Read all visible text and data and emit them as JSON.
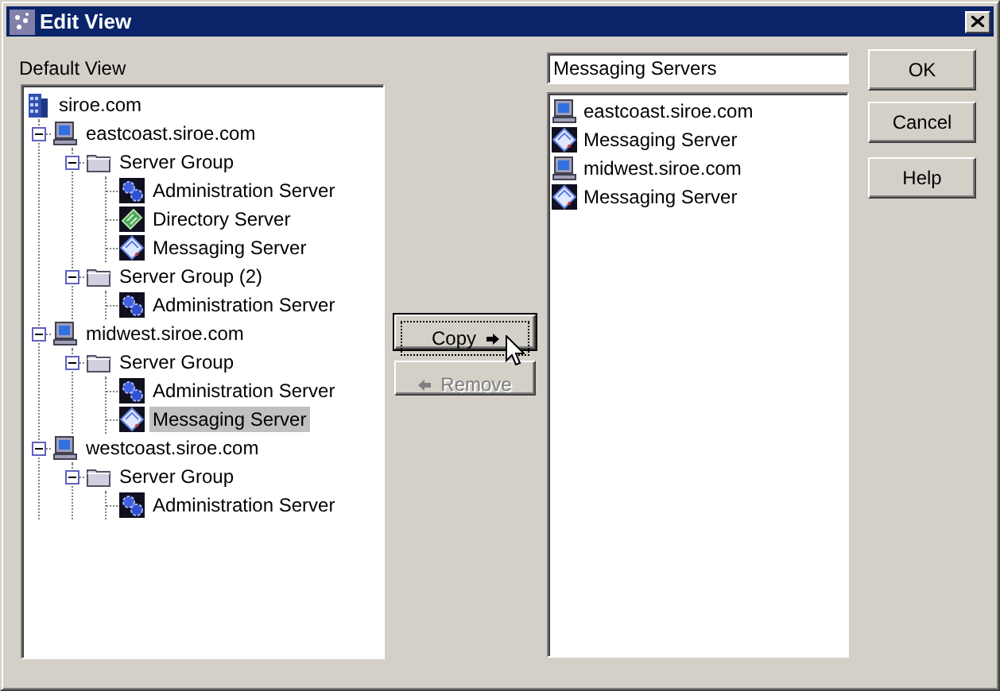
{
  "window": {
    "title": "Edit View"
  },
  "tree": {
    "label": "Default View",
    "nodes": [
      {
        "label": "siroe.com",
        "kind": "domain",
        "selected": false,
        "children": [
          {
            "label": "eastcoast.siroe.com",
            "kind": "host",
            "expanded": true,
            "selected": false,
            "children": [
              {
                "label": "Server Group",
                "kind": "folder",
                "expanded": true,
                "selected": false,
                "children": [
                  {
                    "label": "Administration Server",
                    "kind": "admin",
                    "selected": false
                  },
                  {
                    "label": "Directory Server",
                    "kind": "directory",
                    "selected": false
                  },
                  {
                    "label": "Messaging Server",
                    "kind": "messaging",
                    "selected": false
                  }
                ]
              },
              {
                "label": "Server Group (2)",
                "kind": "folder",
                "expanded": true,
                "selected": false,
                "children": [
                  {
                    "label": "Administration Server",
                    "kind": "admin",
                    "selected": false
                  }
                ]
              }
            ]
          },
          {
            "label": "midwest.siroe.com",
            "kind": "host",
            "expanded": true,
            "selected": false,
            "children": [
              {
                "label": "Server Group",
                "kind": "folder",
                "expanded": true,
                "selected": false,
                "children": [
                  {
                    "label": "Administration Server",
                    "kind": "admin",
                    "selected": false
                  },
                  {
                    "label": "Messaging Server",
                    "kind": "messaging",
                    "selected": true
                  }
                ]
              }
            ]
          },
          {
            "label": "westcoast.siroe.com",
            "kind": "host",
            "expanded": true,
            "selected": false,
            "children": [
              {
                "label": "Server Group",
                "kind": "folder",
                "expanded": true,
                "selected": false,
                "children": [
                  {
                    "label": "Administration Server",
                    "kind": "admin",
                    "selected": false
                  }
                ]
              }
            ]
          }
        ]
      }
    ]
  },
  "view_name": {
    "value": "Messaging Servers"
  },
  "view_items": [
    {
      "label": "eastcoast.siroe.com",
      "kind": "host"
    },
    {
      "label": "Messaging Server",
      "kind": "messaging"
    },
    {
      "label": "midwest.siroe.com",
      "kind": "host"
    },
    {
      "label": "Messaging Server",
      "kind": "messaging"
    }
  ],
  "transfer_buttons": [
    {
      "label": "Copy",
      "kind": "add",
      "disabled": false,
      "focused": true
    },
    {
      "label": "Remove",
      "kind": "remove",
      "disabled": true,
      "focused": false
    }
  ],
  "dialog_buttons": [
    "OK",
    "Cancel",
    "Help"
  ]
}
